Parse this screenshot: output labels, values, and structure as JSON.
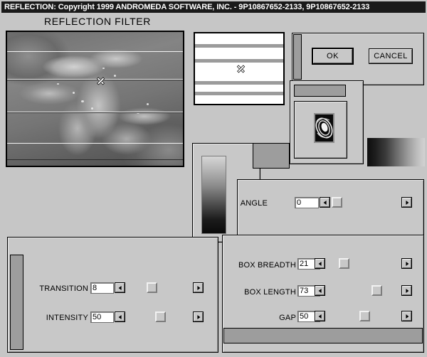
{
  "window": {
    "title": "REFLECTION: Copyright 1999 ANDROMEDA SOFTWARE, INC. - 9P10867652-2133, 9P10867652-2133",
    "heading": "REFLECTION FILTER"
  },
  "buttons": {
    "ok": "OK",
    "cancel": "CANCEL"
  },
  "controls": {
    "angle": {
      "label": "ANGLE",
      "value": "0",
      "dec_icon": "triangle-left-icon",
      "inc_icon": "triangle-right-icon",
      "thumb_pct": 2
    },
    "box_breadth": {
      "label": "BOX BREADTH",
      "value": "21",
      "dec_icon": "triangle-left-icon",
      "inc_icon": "triangle-right-icon",
      "thumb_pct": 21
    },
    "box_length": {
      "label": "BOX LENGTH",
      "value": "73",
      "dec_icon": "triangle-left-icon",
      "inc_icon": "triangle-right-icon",
      "thumb_pct": 73
    },
    "gap": {
      "label": "GAP",
      "value": "50",
      "dec_icon": "triangle-left-icon",
      "inc_icon": "triangle-right-icon",
      "thumb_pct": 50
    },
    "transition": {
      "label": "TRANSITION",
      "value": "8",
      "dec_icon": "triangle-left-icon",
      "inc_icon": "triangle-right-icon",
      "thumb_pct": 38
    },
    "intensity": {
      "label": "INTENSITY",
      "value": "50",
      "dec_icon": "triangle-left-icon",
      "inc_icon": "triangle-right-icon",
      "thumb_pct": 50
    }
  },
  "previews": {
    "image_preview_alt": "grayscale-leaves-photo",
    "strip_preview_alt": "reflection-bands-preview",
    "spiral_thumb_alt": "spiral-swirl-thumbnail",
    "gradient_vertical_alt": "vertical-gray-gradient",
    "gradient_horizontal_alt": "horizontal-gray-gradient"
  },
  "colors": {
    "dialog_face": "#c6c6c6",
    "panel_face": "#c8c8c8",
    "titlebar_bg": "#1a1a1a",
    "titlebar_fg": "#ffffff",
    "shadow": "#7d7d7d",
    "highlight": "#f2f2f2",
    "accent_gray": "#9d9d9d"
  }
}
